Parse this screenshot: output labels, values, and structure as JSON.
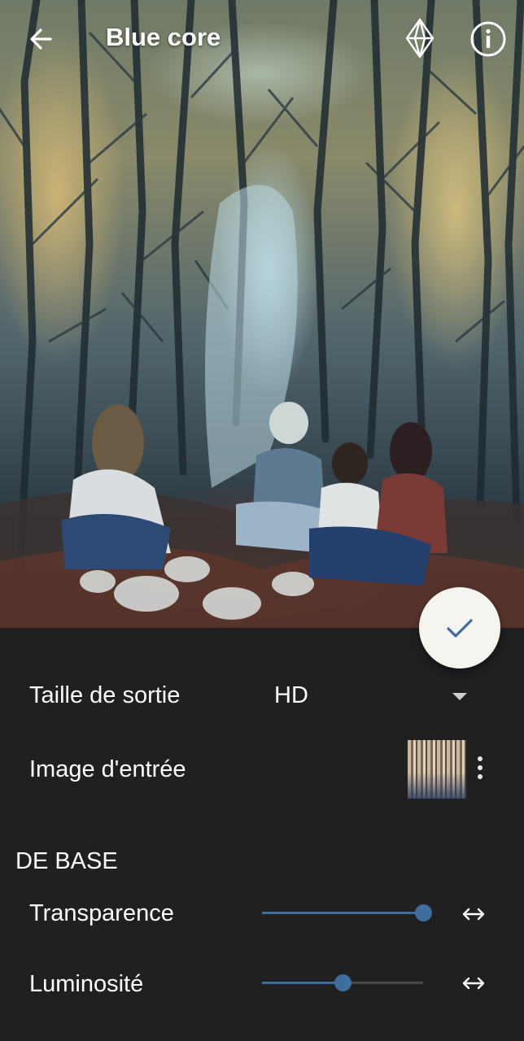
{
  "header": {
    "title": "Blue core",
    "back_icon": "arrow-left-icon",
    "premium_icon": "diamond-icon",
    "info_icon": "info-icon"
  },
  "apply_button": {
    "icon": "check-icon",
    "color": "#3f6d9c"
  },
  "settings": {
    "output_size": {
      "label": "Taille de sortie",
      "value": "HD"
    },
    "input_image": {
      "label": "Image d'entrée"
    },
    "section_title": "DE BASE",
    "sliders": [
      {
        "label": "Transparence",
        "value": 1.0
      },
      {
        "label": "Luminosité",
        "value": 0.5
      }
    ]
  },
  "colors": {
    "accent": "#3f6d9c",
    "panel_background": "#202020",
    "fab_background": "#f6f4ee"
  }
}
